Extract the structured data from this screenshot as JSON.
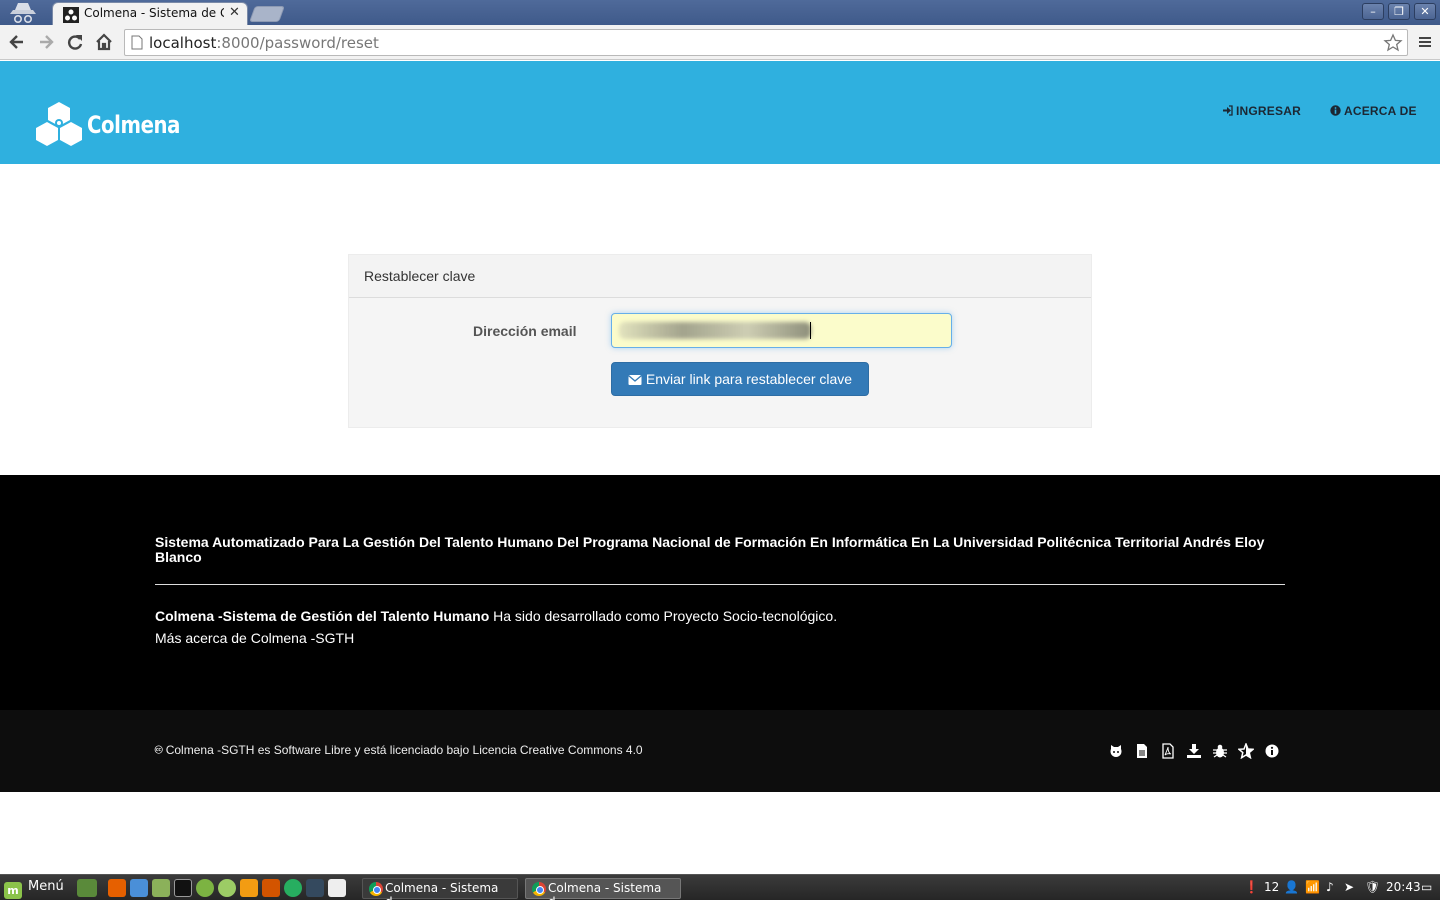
{
  "browser": {
    "tab_title": "Colmena - Sistema de Ge",
    "url_host": "localhost",
    "url_rest": ":8000/password/reset",
    "close_glyph": "✕"
  },
  "header": {
    "brand": "Colmena",
    "nav": [
      {
        "label": "INGRESAR",
        "icon": "sign-in-icon"
      },
      {
        "label": "ACERCA DE",
        "icon": "info-icon"
      }
    ]
  },
  "form": {
    "panel_title": "Restablecer clave",
    "email_label": "Dirección email",
    "email_value": "",
    "submit_label": "Enviar link para restablecer clave"
  },
  "footer": {
    "heading": "Sistema Automatizado Para La Gestión Del Talento Humano Del Programa Nacional de Formación En Informática En La Universidad Politécnica Territorial Andrés Eloy Blanco",
    "about_bold": "Colmena -Sistema de Gestión del Talento Humano",
    "about_rest": " Ha sido desarrollado como Proyecto Socio-tecnológico.",
    "more_link": "Más acerca de Colmena -SGTH",
    "license": "🅭 Colmena -SGTH es Software Libre y está licenciado bajo Licencia Creative Commons 4.0",
    "icons": [
      "github-icon",
      "file-icon",
      "pdf-icon",
      "download-icon",
      "bug-icon",
      "star-icon",
      "info-icon"
    ]
  },
  "taskbar": {
    "menu_label": "Menú",
    "tasks": [
      "Colmena - Sistema d...",
      "Colmena - Sistema d..."
    ],
    "notification_count": "12",
    "clock": "20:43"
  }
}
